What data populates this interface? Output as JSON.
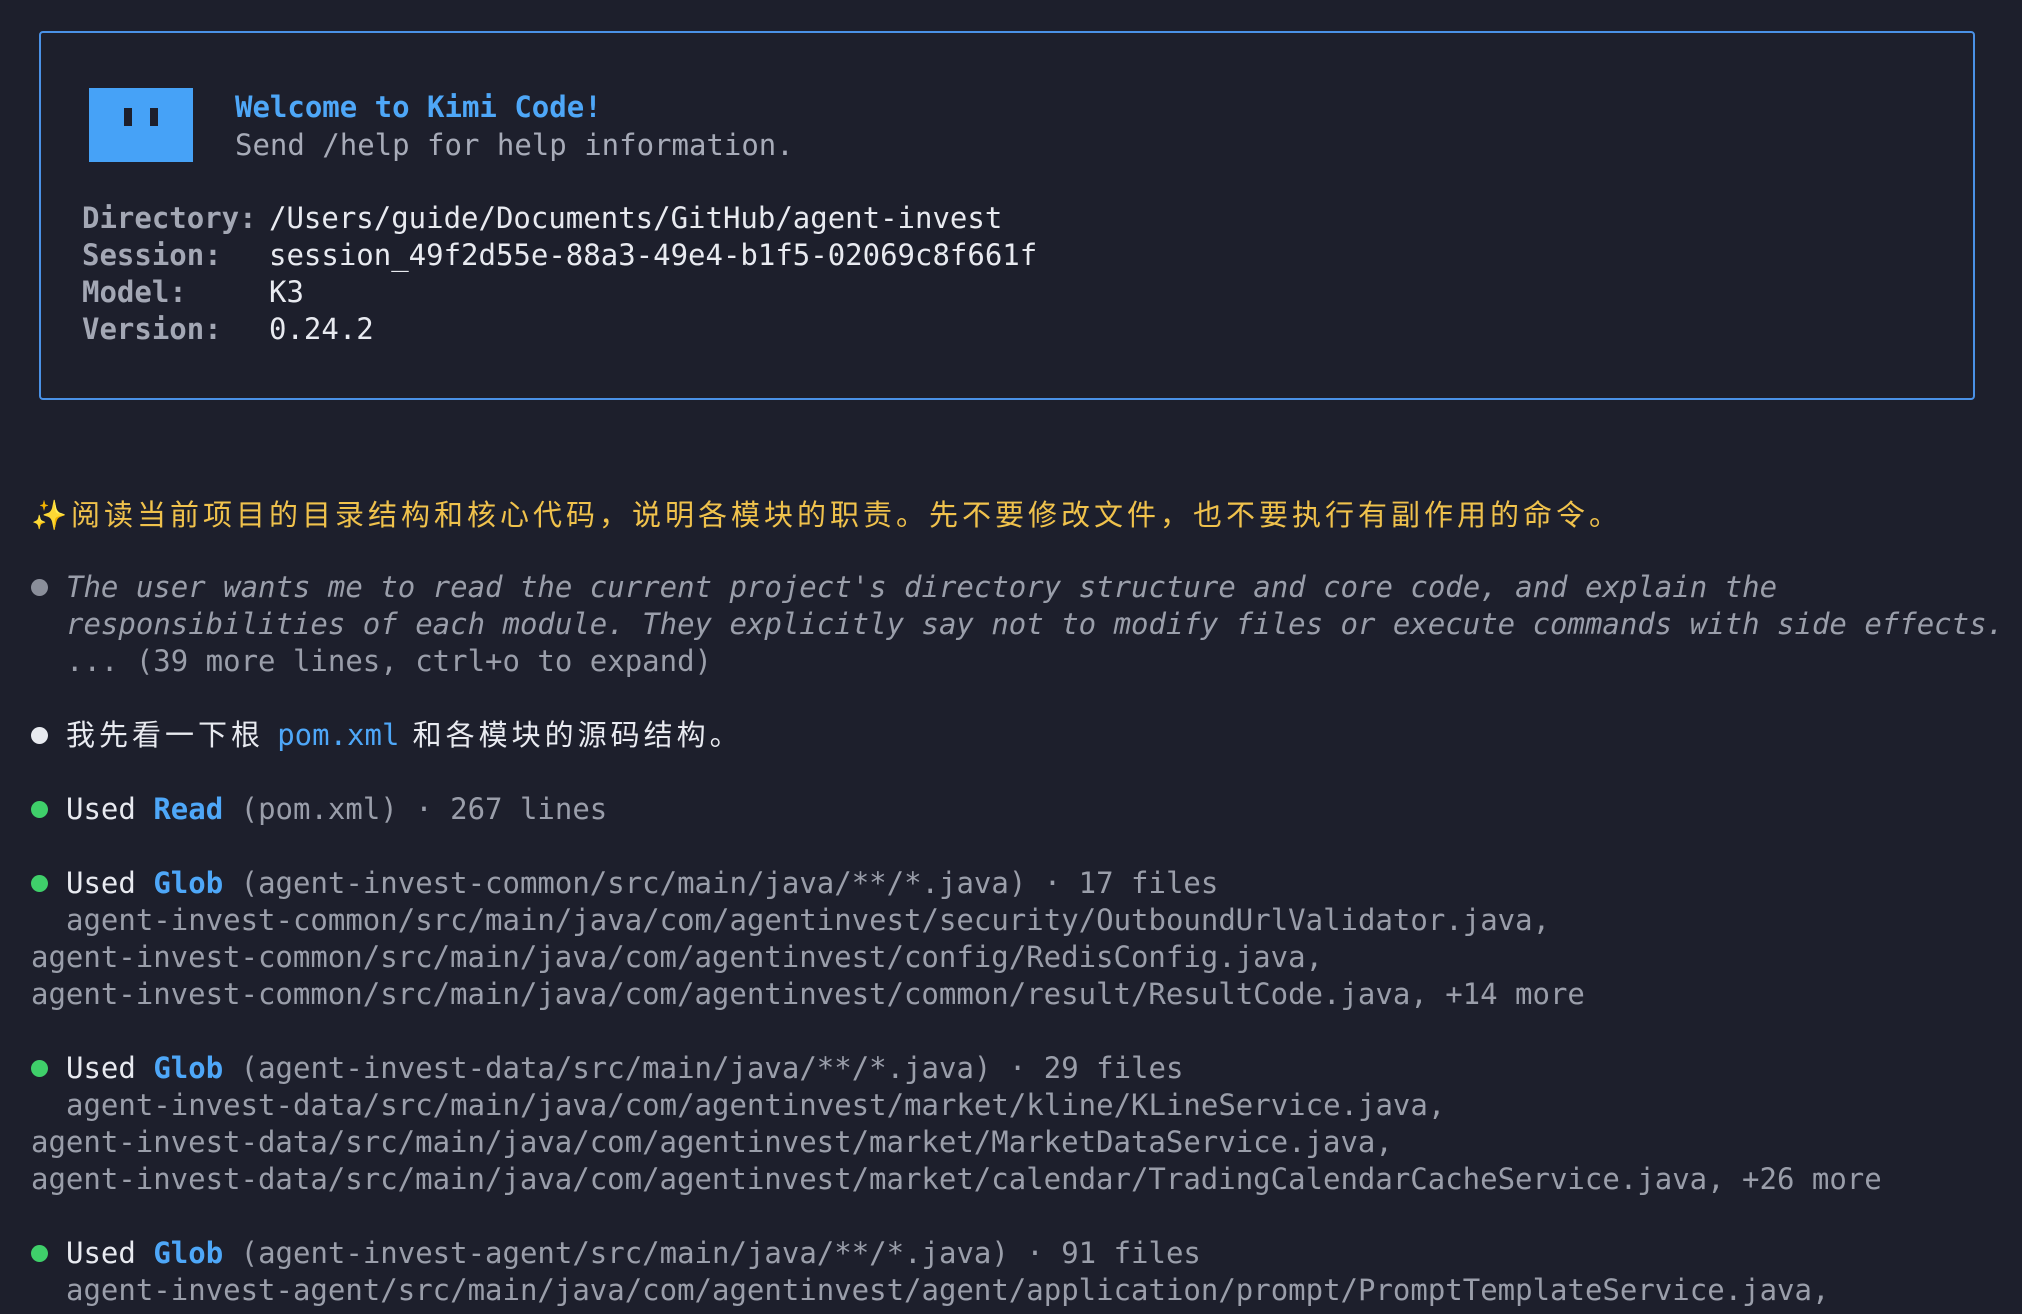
{
  "welcome": {
    "title": "Welcome to Kimi Code!",
    "subtitle": "Send /help for help information.",
    "info": [
      {
        "label": "Directory:",
        "value": "/Users/guide/Documents/GitHub/agent-invest"
      },
      {
        "label": "Session:",
        "value": "session_49f2d55e-88a3-49e4-b1f5-02069c8f661f"
      },
      {
        "label": "Model:",
        "value": "K3"
      },
      {
        "label": "Version:",
        "value": "0.24.2"
      }
    ]
  },
  "prompt": {
    "icon": "✨",
    "text": "阅读当前项目的目录结构和核心代码，说明各模块的职责。先不要修改文件，也不要执行有副作用的命令。"
  },
  "thinking": {
    "line1": "The user wants me to read the current project's directory structure and core code, and explain the",
    "line2": "responsibilities of each module. They explicitly say not to modify files or execute commands with side effects.",
    "line3": "... (39 more lines, ctrl+o to expand)"
  },
  "message": {
    "before": "我先看一下根 ",
    "code": "pom.xml",
    "after": " 和各模块的源码结构。"
  },
  "tools": [
    {
      "used": "Used",
      "tool": "Read",
      "args": " (pom.xml) · 267 lines",
      "results": []
    },
    {
      "used": "Used",
      "tool": "Glob",
      "args": " (agent-invest-common/src/main/java/**/*.java) · 17 files",
      "results": [
        "agent-invest-common/src/main/java/com/agentinvest/security/OutboundUrlValidator.java,",
        "agent-invest-common/src/main/java/com/agentinvest/config/RedisConfig.java,",
        "agent-invest-common/src/main/java/com/agentinvest/common/result/ResultCode.java, +14 more"
      ]
    },
    {
      "used": "Used",
      "tool": "Glob",
      "args": " (agent-invest-data/src/main/java/**/*.java) · 29 files",
      "results": [
        "agent-invest-data/src/main/java/com/agentinvest/market/kline/KLineService.java,",
        "agent-invest-data/src/main/java/com/agentinvest/market/MarketDataService.java,",
        "agent-invest-data/src/main/java/com/agentinvest/market/calendar/TradingCalendarCacheService.java, +26 more"
      ]
    },
    {
      "used": "Used",
      "tool": "Glob",
      "args": " (agent-invest-agent/src/main/java/**/*.java) · 91 files",
      "results": [
        "agent-invest-agent/src/main/java/com/agentinvest/agent/application/prompt/PromptTemplateService.java,"
      ]
    }
  ]
}
